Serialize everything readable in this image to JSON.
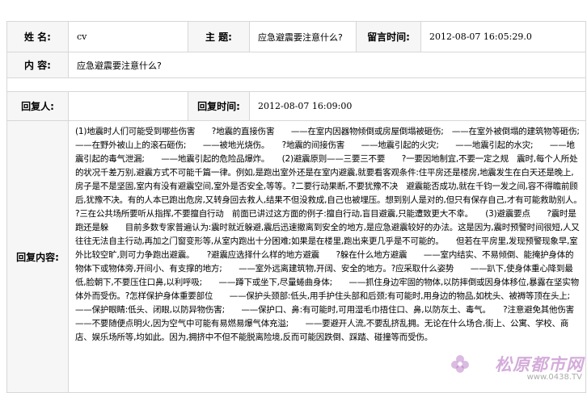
{
  "record": {
    "name_label": "姓  名:",
    "name_value": "cv",
    "subject_label": "主  题:",
    "subject_value": "应急避震要注意什么?",
    "post_time_label": "留言时间:",
    "post_time_value": "2012-08-07 16:05:29.0",
    "content_label": "内  容:",
    "content_value": "应急避震要注意什么?"
  },
  "reply": {
    "replier_label": "回复人:",
    "replier_value": "",
    "reply_time_label": "回复时间:",
    "reply_time_value": "2012-08-07 16:09:00",
    "reply_content_label": "回复内容:",
    "reply_content_value": "(1)地震时人们可能受到哪些伤害　　?地震的直接伤害　　——在室内因器物倾倒或房屋倒塌被砸伤;　——在室外被倒塌的建筑物等砸伤;　　——在野外被山上的滚石砸伤;　　——被地光烧伤。　　?地震的间接伤害　　——地震引起的火灾;　　——地震引起的水灾;　　——地震引起的毒气泄漏;　　——地震引起的危险品爆炸。　　(2)避震原则——三要三不要　　?一要因地制宜,不要一定之规　震时,每个人所处的状况千差万别,避震方式不可能千篇一律。例如,是跑出室外还是在室内避震,就要看客观条件:住平房还是楼房,地震发生在白天还是晚上,房子是不是坚固,室内有没有避震空间,室外是否安全,等等。?二要行动果断,不要犹豫不决　避震能否成功,就在千钧一发之间,容不得瞻前顾后,犹豫不决。有的人本已跑出危房,又转身回去救人,结果不但没救成,自己也被埋压。想到别人是对的,但只有保存自己,才有可能救助别人。　　?三在公共场所要听从指挥,不要擅自行动　前面已讲过这方面的例子:擅自行动,盲目避震,只能遭致更大不幸。　　(3)避震要点　　?震时是跑还是躲　　目前多数专家普遍认为:震时就近躲避,震后迅速撤离到安全的地方,是应急避震较好的办法。这是因为,震时预警时间很短,人又往往无法自主行动,再加之门窗变形等,从室内跑出十分困难;如果是在楼里,跑出来更几乎是不可能的。　　但若在平房里,发现预警现象早,室外比较空旷,则可力争跑出避震。　　?避震应选择什么样的地方避震　　?躲在什么地方避震　　——室内结实、不易倾倒、能掩护身体的物体下或物体旁,开间小、有支撑的地方;　　——室外远离建筑物,开阔、安全的地方。?应采取什么姿势　　——趴下,使身体重心降到最低,脸朝下,不要压住口鼻,以利呼吸;　　——蹲下或坐下,尽量蜷曲身体;　　——抓住身边牢固的物体,以防摔倒或因身体移位,暴露在坚实物体外而受伤。?怎样保护身体重要部位　　——保护头颈部:低头,用手护住头部和后颈;有可能时,用身边的物品,如枕头、被褥等顶在头上;　　——保护眼睛:低头、闭眼,以防异物伤害;　　——保护口、鼻:有可能时,可用湿毛巾捂住口、鼻,以防灰土、毒气。　　?注意避免其他伤害　　——不要随便点明火,因为空气中可能有易燃易爆气体充溢;　　——要避开人流,不要乱挤乱拥。无论在什么场合,街上、公寓、学校、商店、娱乐场所等,均如此。因为,拥挤中不但不能脱离险境,反而可能因跌倒、踩踏、碰撞等而受伤。"
  },
  "watermark": {
    "site_name": "松原都市网",
    "site_url": "www.0438.TV"
  },
  "colors": {
    "border": "#d7d7d7",
    "label_bg": "#f6f6f6",
    "watermark": "#b068bc"
  }
}
